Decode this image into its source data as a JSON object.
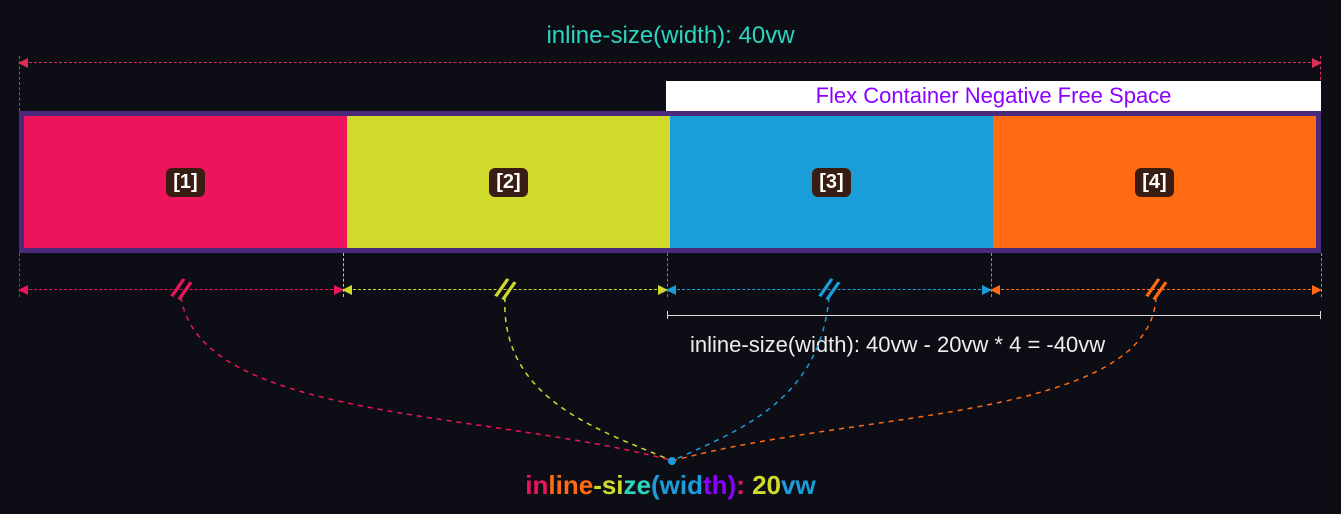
{
  "top_label": "inline-size(width): 40vw",
  "banner": "Flex Container Negative Free Space",
  "items": {
    "i1": "[1]",
    "i2": "[2]",
    "i3": "[3]",
    "i4": "[4]"
  },
  "neg_formula": "inline-size(width): 40vw - 20vw * 4 = -40vw",
  "bottom_label_parts": {
    "p1": "in",
    "p2": "line",
    "p3": "-si",
    "p4": "ze",
    "p5": "(wid",
    "p6": "th)",
    "p7": ": ",
    "p8": "20",
    "p9": "vw"
  },
  "colors": {
    "bg": "#0d0d16",
    "container_border": "#4b2a7b",
    "item1": "#ed145b",
    "item2": "#d0da2c",
    "item3": "#1b9dd9",
    "item4": "#ff6a13",
    "top_label": "#2dd4bf",
    "banner_text": "#8b00ff"
  },
  "diagram": {
    "container_width": "40vw",
    "item_width": "20vw",
    "item_count": 4,
    "free_space": "-40vw"
  }
}
